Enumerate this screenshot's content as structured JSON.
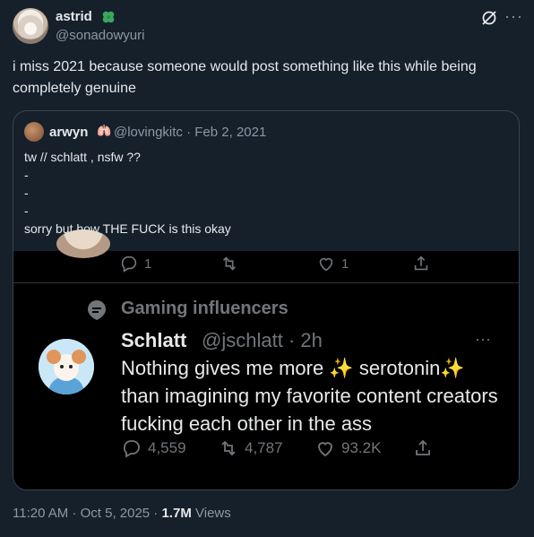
{
  "author": {
    "name": "astrid",
    "handle": "@sonadowyuri",
    "badge_icon": "four-leaf-clover-icon"
  },
  "post": {
    "text": "i miss 2021 because someone would post something like this while being completely genuine"
  },
  "quoted": {
    "name": "arwyn",
    "emoji": "🫁",
    "handle": "@lovingkitc",
    "date": "Feb 2, 2021",
    "lines": [
      "tw // schlatt , nsfw ??",
      "-",
      "-",
      "-",
      "sorry but how THE FUCK is this okay"
    ]
  },
  "screenshot": {
    "top_row": {
      "replies": "1",
      "likes": "1"
    },
    "topic": "Gaming influencers",
    "name": "Schlatt",
    "handle": "@jschlatt",
    "age": "2h",
    "text": "Nothing gives me more ✨ serotonin✨ than imagining my favorite content creators fucking each other in the ass",
    "stats": {
      "replies": "4,559",
      "retweets": "4,787",
      "likes": "93.2K"
    }
  },
  "footer": {
    "timestamp": "11:20 AM · Oct 5, 2025 · ",
    "views_count": "1.7M",
    "views_label": " Views"
  },
  "colors": {
    "background": "#15202b",
    "text": "#e7e9ea",
    "muted": "#8b98a5",
    "clover": "#3ba55c"
  }
}
